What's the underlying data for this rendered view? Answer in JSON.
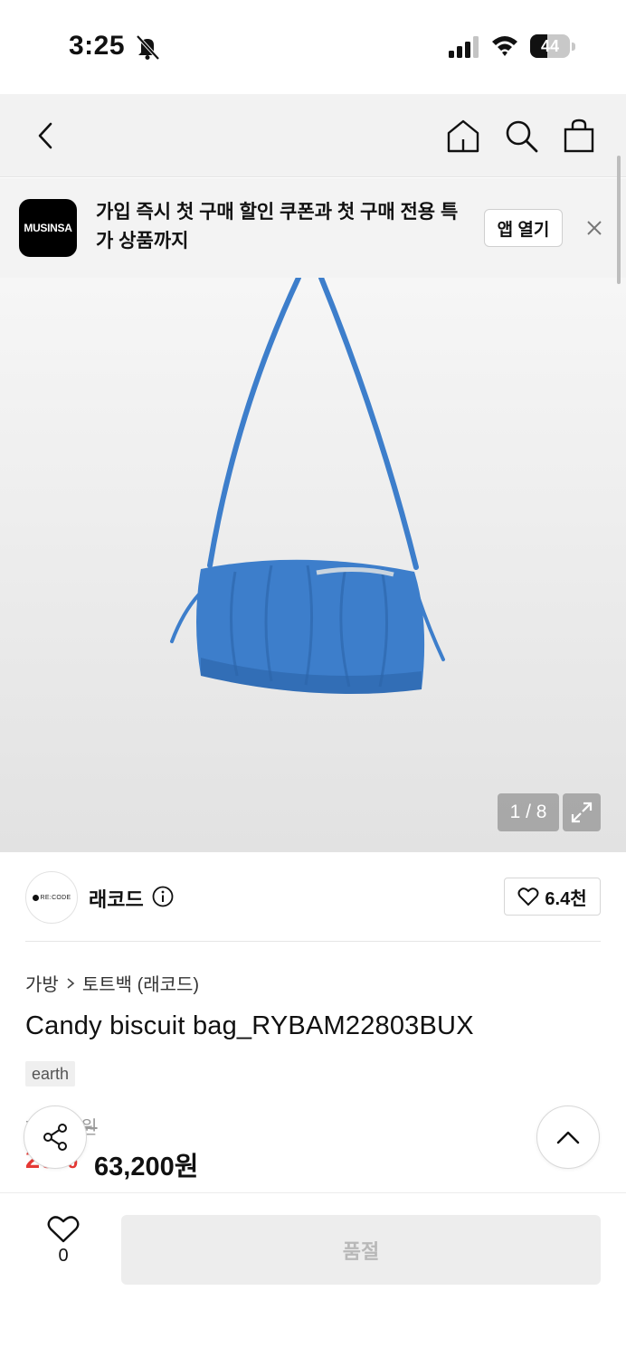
{
  "status_bar": {
    "time": "3:25",
    "battery_level": "44",
    "battery_fraction": 0.44
  },
  "top_nav": {
    "icons": [
      "back-chevron-icon",
      "home-icon",
      "search-icon",
      "shopping-bag-icon"
    ]
  },
  "app_banner": {
    "logo_text": "MUSINSA",
    "message": "가입 즉시 첫 구매 할인 쿠폰과 첫 구매 전용 특가 상품까지",
    "open_app_label": "앱 열기"
  },
  "gallery": {
    "counter": "1 / 8",
    "bag_color": "#3d7ecb"
  },
  "brand": {
    "logo_text": "RE:CODE",
    "name": "래코드",
    "likes": "6.4천"
  },
  "product": {
    "breadcrumb": [
      "가방",
      "토트백 (래코드)"
    ],
    "title": "Candy biscuit bag_RYBAM22803BUX",
    "tag": "earth",
    "original_price": "79,000원",
    "discount": "20%",
    "sale_price": "63,200원"
  },
  "bottom_bar": {
    "wish_count": "0",
    "soldout_label": "품절"
  },
  "colors": {
    "discount_red": "#e53935",
    "nav_bg": "#f2f2f2"
  }
}
